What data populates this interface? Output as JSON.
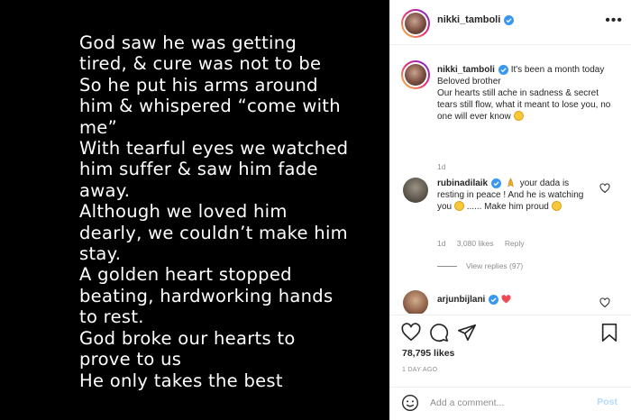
{
  "post_image": {
    "text": "God saw he was getting tired, & cure was not to be\nSo he put his arms around him & whispered “come with me”\nWith tearful eyes we watched him suffer & saw him fade away.\nAlthough we loved him dearly, we couldn’t make him stay.\nA golden heart stopped beating, hardworking hands to rest.\nGod broke our hearts to prove to us\nHe only takes the best"
  },
  "header": {
    "username": "nikki_tamboli",
    "more_label": "•••"
  },
  "caption": {
    "username": "nikki_tamboli",
    "line1": "It's been a month today",
    "line2": "Beloved brother",
    "line3": "Our hearts still ache in sadness & secret tears still flow, what it meant to lose you, no one will ever know",
    "time": "1d"
  },
  "comments": [
    {
      "username": "rubinadilaik",
      "text_a": "your dada is resting in peace ! And he is watching you",
      "text_b": "...... Make him proud",
      "time": "1d",
      "likes": "3,080 likes",
      "reply_label": "Reply",
      "view_replies": "View replies (97)"
    },
    {
      "username": "arjunbijlani"
    }
  ],
  "actions": {
    "likes": "78,795 likes",
    "date": "1 DAY AGO"
  },
  "add_comment": {
    "placeholder": "Add a comment...",
    "post_label": "Post"
  },
  "colors": {
    "verified": "#3897f0",
    "post_button": "#b3dbff",
    "heart_red": "#ed4956"
  },
  "icons": [
    "like-icon",
    "comment-icon",
    "share-icon",
    "save-icon",
    "smile-icon",
    "verified-icon",
    "more-icon"
  ]
}
